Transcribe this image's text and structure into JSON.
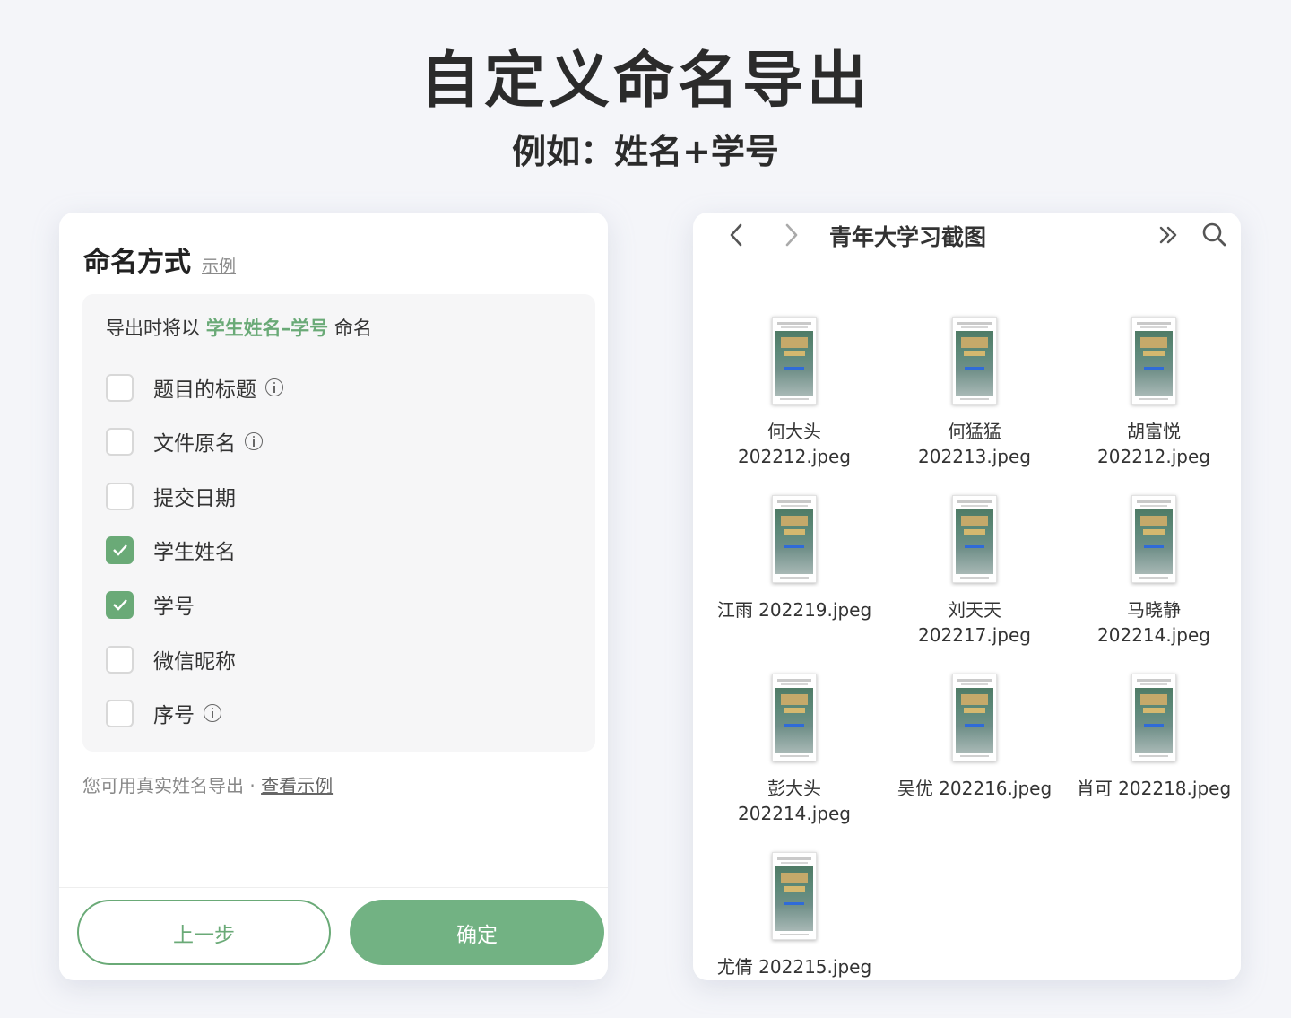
{
  "header": {
    "title": "自定义命名导出",
    "subtitle": "例如：姓名+学号"
  },
  "naming_panel": {
    "title": "命名方式",
    "example_link": "示例",
    "hint_prefix": "导出时将以",
    "hint_highlight": "学生姓名–学号",
    "hint_suffix": "命名",
    "options": [
      {
        "label": "题目的标题",
        "checked": false,
        "info": true
      },
      {
        "label": "文件原名",
        "checked": false,
        "info": true
      },
      {
        "label": "提交日期",
        "checked": false,
        "info": false
      },
      {
        "label": "学生姓名",
        "checked": true,
        "info": false
      },
      {
        "label": "学号",
        "checked": true,
        "info": false
      },
      {
        "label": "微信昵称",
        "checked": false,
        "info": false
      },
      {
        "label": "序号",
        "checked": false,
        "info": true
      }
    ],
    "footnote": "您可用真实姓名导出 ·",
    "footnote_link": "查看示例",
    "prev_button": "上一步",
    "confirm_button": "确定",
    "accent_color": "#6aaa77"
  },
  "file_browser": {
    "folder_title": "青年大学习截图",
    "files": [
      {
        "line1": "何大头",
        "line2": "202212.jpeg"
      },
      {
        "line1": "何猛猛",
        "line2": "202213.jpeg"
      },
      {
        "line1": "胡富悦",
        "line2": "202212.jpeg"
      },
      {
        "line1": "江雨 202219.jpeg",
        "line2": ""
      },
      {
        "line1": "刘天天",
        "line2": "202217.jpeg"
      },
      {
        "line1": "马晓静",
        "line2": "202214.jpeg"
      },
      {
        "line1": "彭大头",
        "line2": "202214.jpeg"
      },
      {
        "line1": "吴优 202216.jpeg",
        "line2": ""
      },
      {
        "line1": "肖可 202218.jpeg",
        "line2": ""
      },
      {
        "line1": "尤倩 202215.jpeg",
        "line2": ""
      }
    ],
    "icons": [
      "chevron-left-icon",
      "chevron-right-icon",
      "double-chevron-right-icon",
      "search-icon"
    ]
  }
}
